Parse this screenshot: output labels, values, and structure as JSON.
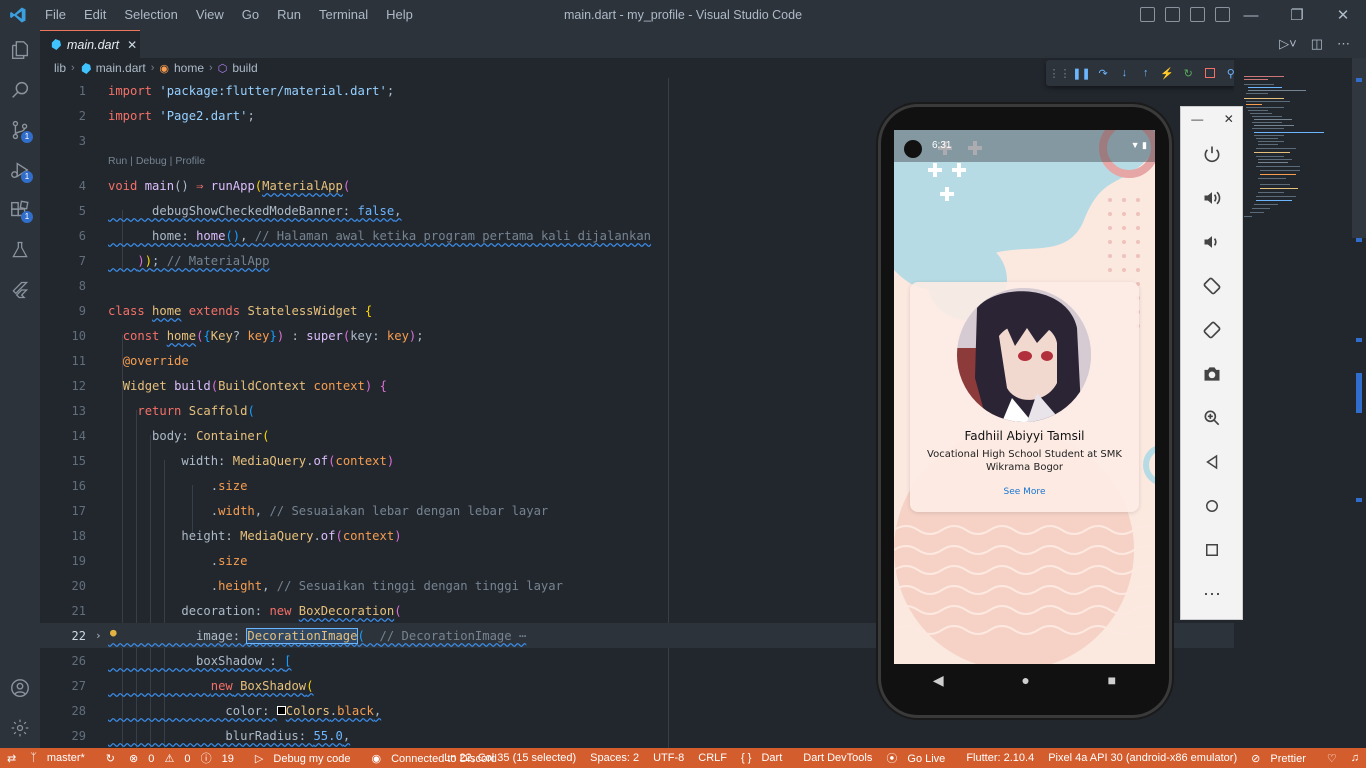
{
  "titlebar": {
    "menu": [
      "File",
      "Edit",
      "Selection",
      "View",
      "Go",
      "Run",
      "Terminal",
      "Help"
    ],
    "title": "main.dart - my_profile - Visual Studio Code"
  },
  "activity_bar": {
    "items": [
      "explorer-icon",
      "search-icon",
      "source-control-icon",
      "run-debug-icon",
      "extensions-icon",
      "testing-icon",
      "flutter-icon"
    ],
    "badges": {
      "source_control": "1",
      "run_debug": "1",
      "extensions": "1"
    },
    "bottom": [
      "account-icon",
      "manage-gear-icon"
    ]
  },
  "tab": {
    "label": "main.dart",
    "close": "✕"
  },
  "breadcrumb": {
    "folder": "lib",
    "file": "main.dart",
    "class": "home",
    "method": "build"
  },
  "editor": {
    "codelens": "Run | Debug | Profile",
    "line_numbers": [
      "1",
      "2",
      "3",
      "4",
      "5",
      "6",
      "7",
      "8",
      "9",
      "10",
      "11",
      "12",
      "13",
      "14",
      "15",
      "16",
      "17",
      "18",
      "19",
      "20",
      "21",
      "22",
      "26",
      "27",
      "28",
      "29"
    ],
    "active_line": "22"
  },
  "phone": {
    "time": "6:31",
    "name": "Fadhiil Abiyyi Tamsil",
    "desc": "Vocational High School Student at SMK Wikrama Bogor",
    "button": "See More"
  },
  "statusbar": {
    "branch": "master*",
    "errors": "0",
    "warnings": "0",
    "info": "19",
    "debug": "Debug my code",
    "discord": "Connected to Discord",
    "position": "Ln 22, Col 35 (15 selected)",
    "spaces": "Spaces: 2",
    "encoding": "UTF-8",
    "eol": "CRLF",
    "language": "Dart",
    "devtools": "Dart DevTools",
    "golive": "Go Live",
    "flutter": "Flutter: 2.10.4",
    "device": "Pixel 4a API 30 (android-x86 emulator)",
    "prettier": "Prettier"
  },
  "colors": {
    "statusbar": "#d45d2e",
    "editor_bg": "#22272e",
    "chrome_bg": "#2d333b"
  }
}
